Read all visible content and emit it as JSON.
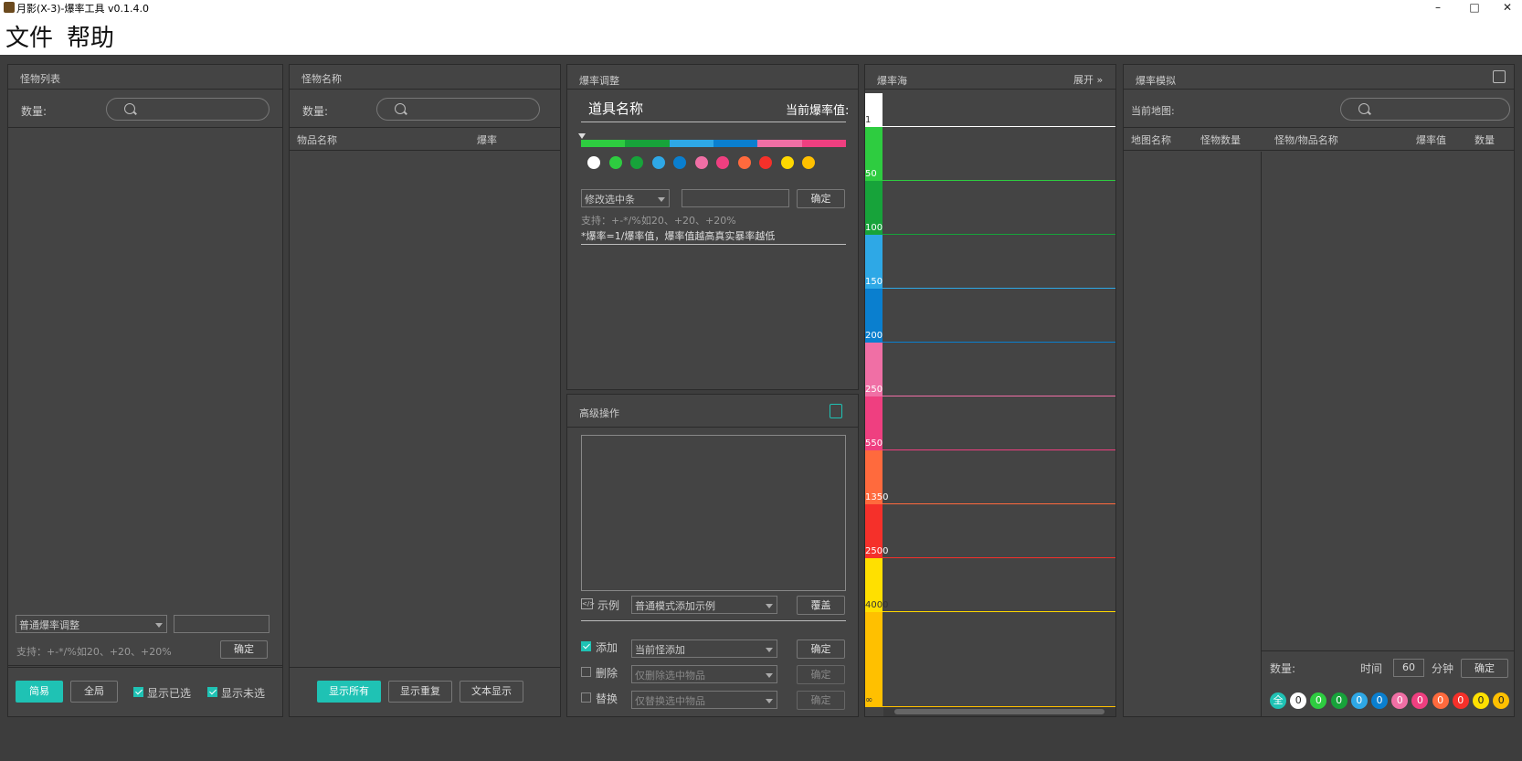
{
  "window": {
    "title": "月影(X-3)-爆率工具 v0.1.4.0",
    "minimize": "–",
    "maximize": "□",
    "close": "✕"
  },
  "menu": [
    "文件",
    "帮助"
  ],
  "monster_list": {
    "title": "怪物列表",
    "count_label": "数量:",
    "adjust_select": "普通爆率调整",
    "support_text": "支持：+-*/%如20、+20、+20%",
    "confirm": "确定",
    "buttons": {
      "simple": "简易",
      "global": "全局"
    },
    "show_selected": "显示已选",
    "show_unselected": "显示未选"
  },
  "monster_name": {
    "title": "怪物名称",
    "count_label": "数量:",
    "columns": [
      "物品名称",
      "爆率"
    ],
    "buttons": [
      "显示所有",
      "显示重复",
      "文本显示"
    ]
  },
  "rate_adjust": {
    "title": "爆率调整",
    "item_name_label": "道具名称",
    "current_value_label": "当前爆率值:",
    "modify_select": "修改选中条",
    "confirm": "确定",
    "support_text": "支持：+-*/%如20、+20、+20%",
    "note": "*爆率=1/爆率值，爆率值越高真实暴率越低",
    "bar_colors": [
      "#2ecc40",
      "#17a33a",
      "#2ea8e6",
      "#0a7fcf",
      "#f06fa5",
      "#ef3f80"
    ],
    "dot_colors": [
      "#ffffff",
      "#2ecc40",
      "#17a33a",
      "#2ea8e6",
      "#0a7fcf",
      "#f06fa5",
      "#ef3f80",
      "#ff6a3d",
      "#f5302a",
      "#ffd800",
      "#ffc000"
    ]
  },
  "advanced": {
    "title": "高级操作",
    "example_label": "示例",
    "example_select": "普通模式添加示例",
    "overwrite": "覆盖",
    "add_label": "添加",
    "add_select": "当前怪添加",
    "add_confirm": "确定",
    "delete_label": "删除",
    "delete_select": "仅删除选中物品",
    "delete_confirm": "确定",
    "replace_label": "替换",
    "replace_select": "仅替换选中物品",
    "replace_confirm": "确定"
  },
  "rate_sea": {
    "title": "爆率海",
    "expand": "展开",
    "scale": [
      {
        "label": "1",
        "color": "#ffffff",
        "line": "#ffffff"
      },
      {
        "label": "50",
        "color": "#2ecc40",
        "line": "#2ecc40"
      },
      {
        "label": "100",
        "color": "#17a33a",
        "line": "#17a33a"
      },
      {
        "label": "150",
        "color": "#2ea8e6",
        "line": "#2ea8e6"
      },
      {
        "label": "200",
        "color": "#0a7fcf",
        "line": "#0a7fcf"
      },
      {
        "label": "250",
        "color": "#f06fa5",
        "line": "#f06fa5"
      },
      {
        "label": "550",
        "color": "#ef3f80",
        "line": "#ef3f80"
      },
      {
        "label": "1350",
        "color": "#ff6a3d",
        "line": "#ff6a3d"
      },
      {
        "label": "2500",
        "color": "#f5302a",
        "line": "#f5302a"
      },
      {
        "label": "4000",
        "color": "#ffe000",
        "line": "#ffd800"
      },
      {
        "label": "∞",
        "color": "#ffc000",
        "line": "#ffc000"
      }
    ]
  },
  "simulation": {
    "title": "爆率模拟",
    "map_label": "当前地图:",
    "columns": [
      "地图名称",
      "怪物数量",
      "怪物/物品名称",
      "爆率值",
      "数量"
    ],
    "count_label": "数量:",
    "time_label": "时间",
    "time_value": "60",
    "minute_label": "分钟",
    "confirm": "确定",
    "filters": [
      {
        "label": "全",
        "color": "#1fc2b4"
      },
      {
        "label": "0",
        "color": "#ffffff"
      },
      {
        "label": "0",
        "color": "#2ecc40"
      },
      {
        "label": "0",
        "color": "#17a33a"
      },
      {
        "label": "0",
        "color": "#2ea8e6"
      },
      {
        "label": "0",
        "color": "#0a7fcf"
      },
      {
        "label": "0",
        "color": "#f06fa5"
      },
      {
        "label": "0",
        "color": "#ef3f80"
      },
      {
        "label": "0",
        "color": "#ff6a3d"
      },
      {
        "label": "0",
        "color": "#f5302a"
      },
      {
        "label": "0",
        "color": "#ffe000"
      },
      {
        "label": "0",
        "color": "#ffc000"
      }
    ]
  }
}
